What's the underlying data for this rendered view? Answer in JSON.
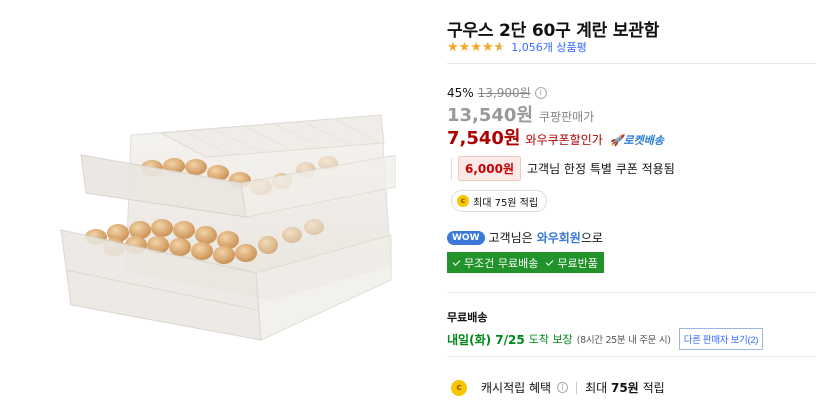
{
  "product": {
    "title": "구우스 2단 60구 계란 보관함",
    "rating": 4.5,
    "review_count": "1,056개 상품평"
  },
  "pricing": {
    "discount_rate": "45%",
    "original_price": "13,900원",
    "sale_price": "13,540원",
    "sale_label": "쿠팡판매가",
    "wow_price": "7,540원",
    "wow_label": "와우쿠폰할인가",
    "rocket_badge": "로켓배송"
  },
  "coupon": {
    "amount": "6,000원",
    "text": "고객님 한정 특별 쿠폰 적용됨"
  },
  "cash_chip": {
    "text": "최대 75원 적립"
  },
  "wow_member": {
    "badge": "WOW",
    "prefix": "고객님은",
    "strong": "와우회원",
    "suffix": "으로"
  },
  "free_banner": {
    "item1": "무조건 무료배송",
    "item2": "무료반품"
  },
  "shipping": {
    "title": "무료배송",
    "date": "내일(화) 7/25",
    "date_suffix": "도착 보장",
    "note": "(8시간 25분 내 주문 시)",
    "other_sellers": "다른 판매자 보기(2)"
  },
  "cash_benefit": {
    "label": "캐시적립 혜택",
    "prefix": "최대",
    "amount": "75원",
    "suffix": "적립"
  },
  "colors": {
    "wow_red": "#ae0000",
    "link_blue": "#346aff",
    "delivery_green": "#00891a",
    "banner_green": "#22922b",
    "star": "#f5a623"
  },
  "icons": [
    "info-icon",
    "rocket-icon",
    "coin-icon",
    "check-icon",
    "star-icon"
  ]
}
